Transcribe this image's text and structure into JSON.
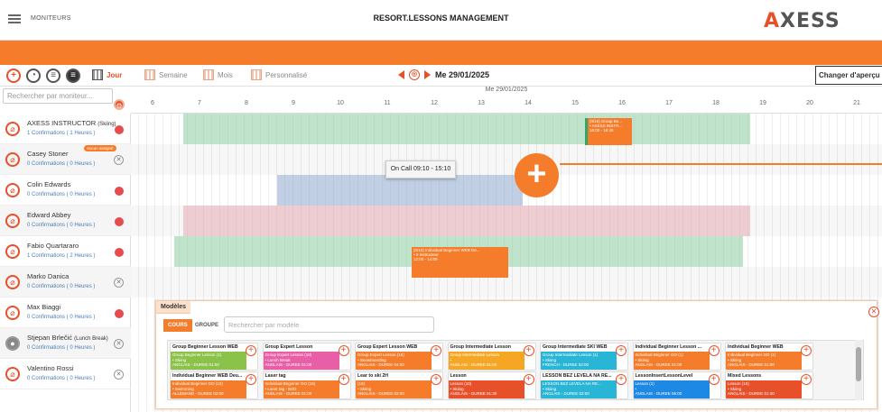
{
  "header": {
    "menu_label": "MONITEURS",
    "title": "RESORT.LESSONS MANAGEMENT",
    "logo": "AXESS"
  },
  "toolbar": {
    "views": [
      {
        "label": "Jour",
        "active": true
      },
      {
        "label": "Semaine",
        "active": false
      },
      {
        "label": "Mois",
        "active": false
      },
      {
        "label": "Personnalisé",
        "active": false
      }
    ],
    "date": "Me 29/01/2025",
    "change_view": "Changer d'aperçu"
  },
  "search": {
    "placeholder": "Rechercher par moniteur..."
  },
  "grid": {
    "date_label": "Me 29/01/2025",
    "hours": [
      "6",
      "7",
      "8",
      "9",
      "10",
      "11",
      "12",
      "13",
      "14",
      "15",
      "16",
      "17",
      "18",
      "19",
      "20",
      "21"
    ]
  },
  "instructors": [
    {
      "name": "AXESS INSTRUCTOR",
      "sub": "(Skiing)",
      "conf": "1 Confirmations ( 1 Heures )",
      "status": "dot"
    },
    {
      "name": "Casey Stoner",
      "sub": "",
      "conf": "0 Confirmations ( 0 Heures )",
      "status": "x",
      "badge": "Aucun assigné"
    },
    {
      "name": "Colin Edwards",
      "sub": "",
      "conf": "0 Confirmations ( 0 Heures )",
      "status": "dot"
    },
    {
      "name": "Edward Abbey",
      "sub": "",
      "conf": "0 Confirmations ( 0 Heures )",
      "status": "dot"
    },
    {
      "name": "Fabio Quartararo",
      "sub": "",
      "conf": "1 Confirmations ( 2 Heures )",
      "status": "dot"
    },
    {
      "name": "Marko Danica",
      "sub": "",
      "conf": "0 Confirmations ( 0 Heures )",
      "status": "x"
    },
    {
      "name": "Max Biaggi",
      "sub": "",
      "conf": "0 Confirmations ( 0 Heures )",
      "status": "dot"
    },
    {
      "name": "Stjepan Brlečić",
      "sub": "(Lunch Break)",
      "conf": "0 Confirmations ( 0 Heures )",
      "status": "x"
    },
    {
      "name": "Valentino Rossi",
      "sub": "",
      "conf": "0 Confirmations ( 0 Heures )",
      "status": "x"
    }
  ],
  "events": {
    "axess": {
      "l1": "(0/15) Group Be...",
      "l2": "• AXESS INSTR...",
      "l3": "16:00 - 16:45"
    },
    "fabio": {
      "l1": "(0/10) Individual Beginner WEB De...",
      "l2": "• 0 Instructeur",
      "l3": "12:00 - 14:00"
    },
    "oncall": "On Call 09:10 - 15:10"
  },
  "modeles": {
    "title": "Modèles",
    "tabs": [
      "COURS",
      "GROUPE"
    ],
    "search_placeholder": "Rechercher par modèle",
    "cards": [
      {
        "title": "Group Beginner Lesson WEB",
        "l1": "Group Beginner Lesson (1)",
        "l2": "• Skiing",
        "l3": "ANGLAIS - DUREE 01:00",
        "color": "#8bc34a"
      },
      {
        "title": "Group Expert Lesson",
        "l1": "Group Expert Lesson (10)",
        "l2": "• Lunch Break",
        "l3": "ANGLAIS - DUREE 01:00",
        "color": "#e85fa8"
      },
      {
        "title": "Group Expert Lesson WEB",
        "l1": "Group Expert Lesson (15)",
        "l2": "• Snowboarding",
        "l3": "ANGLAIS - DUREE 04:00",
        "color": "#f57c2a"
      },
      {
        "title": "Group Intermediate Lesson",
        "l1": "Group Intermediate Lesson",
        "l2": "• ",
        "l3": "ANGLAIS - DUREE 01:00",
        "color": "#f5a623"
      },
      {
        "title": "Group Intermediate SKI WEB",
        "l1": "Group Intermediate Lesson (1)",
        "l2": "• Skiing",
        "l3": "FRENCH - DUREE 02:00",
        "color": "#29b6d6"
      },
      {
        "title": "Individual Beginner Lesson ...",
        "l1": "Individual Beginner GO (1)",
        "l2": "• Skiing",
        "l3": "ANGLAIS - DUREE 01:00",
        "color": "#f57c2a"
      },
      {
        "title": "Individual Beginner WEB",
        "l1": "Individual Beginner GO (1)",
        "l2": "• Skiing",
        "l3": "ANGLAIS - DUREE 01:00",
        "color": "#f57c2a"
      },
      {
        "title": "Individual Beginner WEB Deu...",
        "l1": "Individual Beginner GO (10)",
        "l2": "• Swimming",
        "l3": "ALLEMAND - DUREE 02:00",
        "color": "#f57c2a"
      },
      {
        "title": "Laser tag",
        "l1": "Individual Beginner GO (15)",
        "l2": "• Laser tag - 8x/D",
        "l3": "ANGLAIS - DUREE 01:00",
        "color": "#f57c2a"
      },
      {
        "title": "Lear to ski 2H",
        "l1": "(10)",
        "l2": "• Skiing",
        "l3": "ANGLAIS - DUREE 02:00",
        "color": "#f57c2a"
      },
      {
        "title": "Lesson",
        "l1": "Lesson (10)",
        "l2": "• Skiing",
        "l3": "ANGLAIS - DUREE 01:30",
        "color": "#e8502a"
      },
      {
        "title": "LESSON BEZ LEVELA NA RE...",
        "l1": "LESSON BEZ LEVELA NA RE...",
        "l2": "• Skiing",
        "l3": "ANGLAIS - DUREE 02:00",
        "color": "#29b6d6"
      },
      {
        "title": "LessonInsertLessonLevel",
        "l1": "Lesson (1)",
        "l2": "• ",
        "l3": "ANGLAIS - DUREE 06:00",
        "color": "#1e88e5"
      },
      {
        "title": "Mixed Lessons",
        "l1": "Lesson (10)",
        "l2": "• Skiing",
        "l3": "ANGLAIS - DUREE 01:30",
        "color": "#e8502a"
      }
    ]
  }
}
